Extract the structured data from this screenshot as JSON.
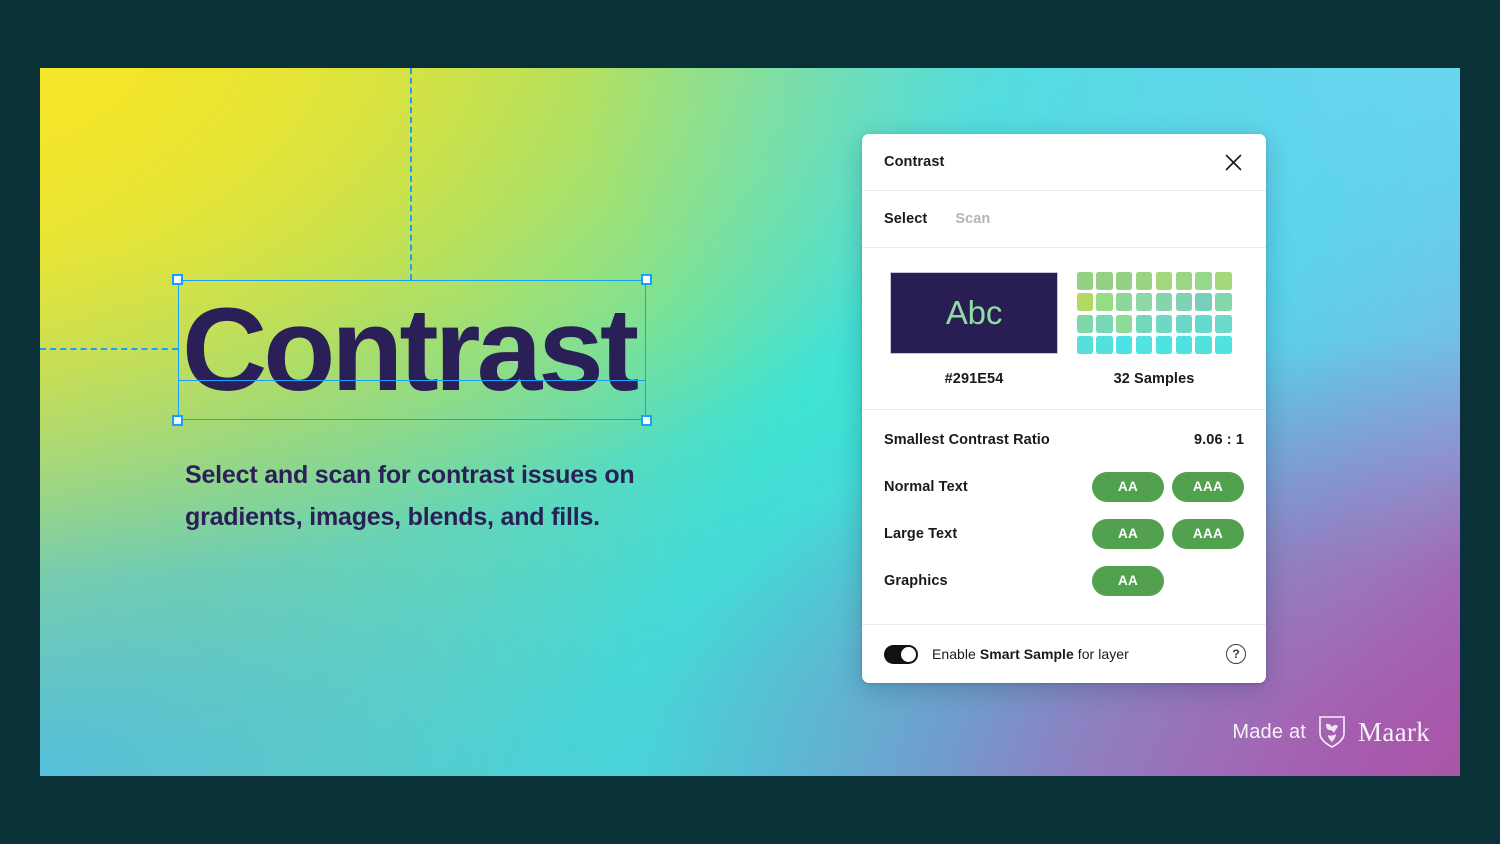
{
  "theme": {
    "page_background": "#0A3038",
    "selection_blue": "#18A0FB",
    "headline_color": "#2B1F57",
    "badge_green": "#52A14F",
    "panel_background": "#FFFFFF"
  },
  "canvas": {
    "headline": "Contrast",
    "subcopy": "Select and scan for contrast issues on gradients, images, blends, and fills.",
    "gradient_stops": [
      "#F5E527",
      "#8FDD7E",
      "#3FE3D2",
      "#49CFE6",
      "#69D6EF",
      "#56BFDB",
      "#A856AA"
    ],
    "watermark": {
      "prefix": "Made at",
      "brand": "Maark",
      "icon": "shield-icon"
    }
  },
  "panel": {
    "title": "Contrast",
    "close_icon": "close-icon",
    "tabs": [
      {
        "label": "Select",
        "active": true
      },
      {
        "label": "Scan",
        "active": false
      }
    ],
    "foreground_sample": {
      "preview_text": "Abc",
      "hex": "#291E54",
      "text_color": "#8FDCA0"
    },
    "background_samples": {
      "label": "32 Samples",
      "count": 32,
      "columns": 8,
      "rows": 4,
      "colors": [
        "#93D183",
        "#93D184",
        "#93D184",
        "#9BD47F",
        "#A4D77C",
        "#9CD584",
        "#96D88D",
        "#A3D97A",
        "#B3D962",
        "#93DD84",
        "#8ED79A",
        "#8ED7A4",
        "#84D4AC",
        "#80D2B4",
        "#76D0BC",
        "#84D6AB",
        "#7ED9A7",
        "#76D8B6",
        "#8DDB94",
        "#74D9BC",
        "#6DD9C4",
        "#69DAC9",
        "#62DBCF",
        "#6ADACA",
        "#58DFD9",
        "#55E0DD",
        "#4BE3E6",
        "#52E2DF",
        "#4EE3E3",
        "#4FE2E0",
        "#52E1DC",
        "#52E2DE"
      ]
    },
    "metrics": [
      {
        "label": "Smallest Contrast Ratio",
        "value": "9.06 : 1",
        "type": "value"
      },
      {
        "label": "Normal Text",
        "badges": [
          "AA",
          "AAA"
        ],
        "type": "badges"
      },
      {
        "label": "Large Text",
        "badges": [
          "AA",
          "AAA"
        ],
        "type": "badges"
      },
      {
        "label": "Graphics",
        "badges": [
          "AA"
        ],
        "type": "badges"
      }
    ],
    "footer": {
      "toggle_on": true,
      "text_before": "Enable ",
      "text_bold": "Smart Sample",
      "text_after": " for layer",
      "help_icon": "question-mark-icon",
      "help_label": "?"
    }
  }
}
